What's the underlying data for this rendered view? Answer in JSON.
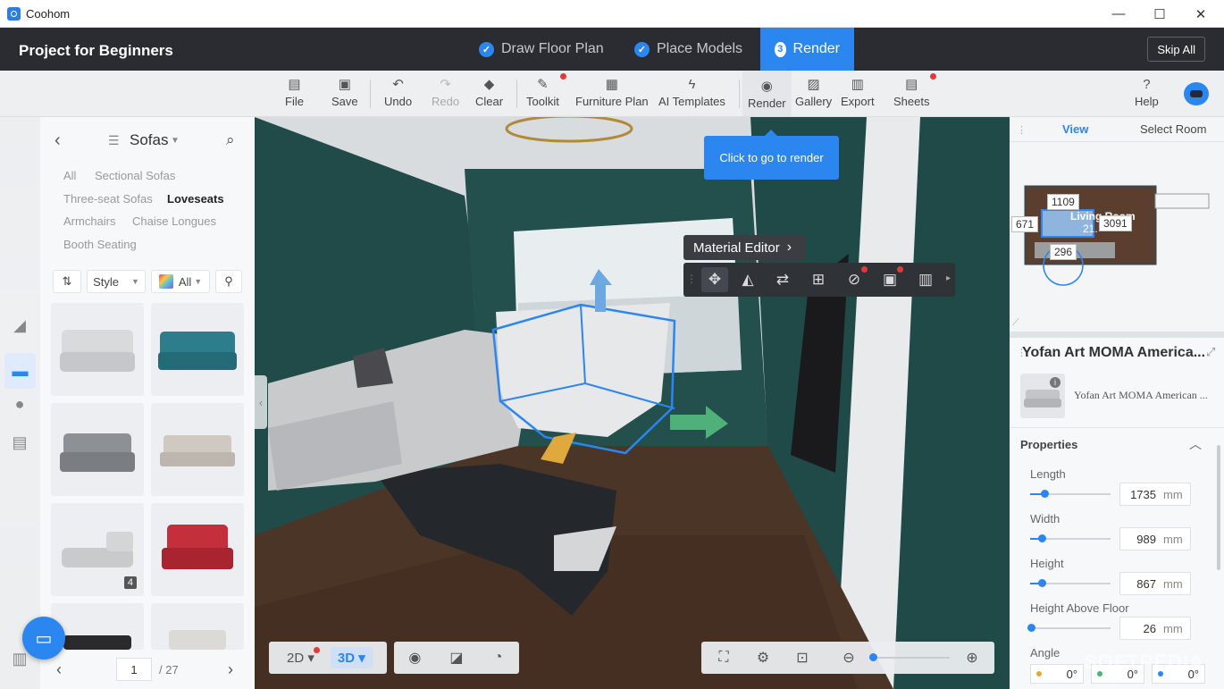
{
  "window": {
    "title": "Coohom",
    "minimize": "—",
    "maximize": "☐",
    "close": "✕"
  },
  "project": {
    "title": "Project for Beginners"
  },
  "steps": [
    {
      "label": "Draw Floor Plan",
      "marker": "✓"
    },
    {
      "label": "Place Models",
      "marker": "✓"
    },
    {
      "label": "Render",
      "marker": "3"
    }
  ],
  "skip_all": "Skip All",
  "toolbar": {
    "file": "File",
    "save": "Save",
    "undo": "Undo",
    "redo": "Redo",
    "clear": "Clear",
    "toolkit": "Toolkit",
    "furniture_plan": "Furniture Plan",
    "ai_templates": "AI Templates",
    "render": "Render",
    "gallery": "Gallery",
    "export": "Export",
    "sheets": "Sheets",
    "help": "Help"
  },
  "tooltip": "Click to go to render",
  "material_editor": "Material Editor",
  "catalog": {
    "category": "Sofas",
    "tags": [
      "All",
      "Sectional Sofas",
      "Three-seat Sofas",
      "Loveseats",
      "Armchairs",
      "Chaise Longues",
      "Booth Seating"
    ],
    "selected_tag": "Loveseats",
    "style_filter": "Style",
    "color_filter": "All",
    "tile_badge": "4",
    "page_current": "1",
    "page_total": "/ 27"
  },
  "minimap": {
    "tab_view": "View",
    "tab_select_room": "Select Room",
    "room_label": "Living Room",
    "room_area": "21.",
    "dims": [
      "1109",
      "671",
      "3091",
      "296"
    ]
  },
  "props": {
    "model_title": "Yofan Art MOMA America...",
    "model_name": "Yofan Art MOMA American ...",
    "section": "Properties",
    "fields": [
      {
        "label": "Length",
        "value": "1735",
        "unit": "mm",
        "level": 0.18
      },
      {
        "label": "Width",
        "value": "989",
        "unit": "mm",
        "level": 0.14
      },
      {
        "label": "Height",
        "value": "867",
        "unit": "mm",
        "level": 0.14
      },
      {
        "label": "Height Above Floor",
        "value": "26",
        "unit": "mm",
        "level": 0.01
      }
    ],
    "angle_label": "Angle",
    "angle_values": [
      "0°",
      "0°",
      "0°"
    ]
  },
  "view_modes": {
    "mode_2d": "2D",
    "mode_3d": "3D"
  },
  "watermark": "SOFTPEDIA",
  "colors": {
    "accent": "#2b86f0",
    "header_bg": "#2a2c31",
    "wall": "#1f4a48",
    "floor": "#4a3526",
    "notification": "#e53935"
  }
}
